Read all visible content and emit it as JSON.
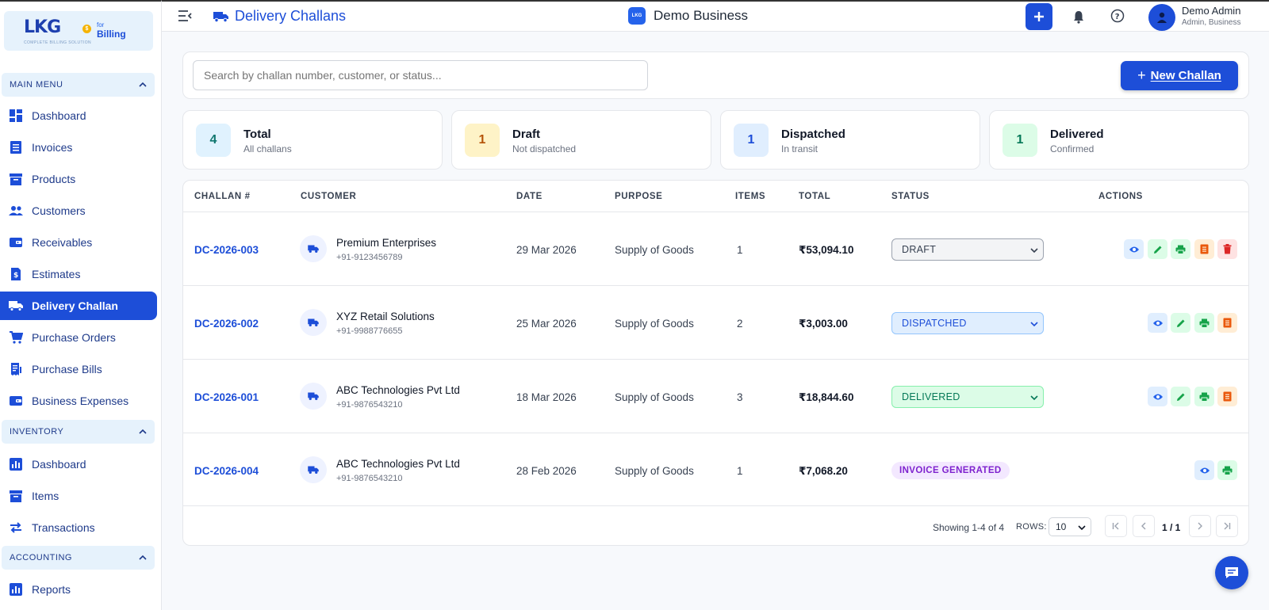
{
  "sidebar": {
    "logo": {
      "brand": "LKG",
      "coin": "$",
      "for": "for",
      "billing": "Billing",
      "tagline": "COMPLETE BILLING SOLUTION"
    },
    "sections": {
      "main": "MAIN MENU",
      "inventory": "INVENTORY",
      "accounting": "ACCOUNTING"
    },
    "items": {
      "dashboard": "Dashboard",
      "invoices": "Invoices",
      "products": "Products",
      "customers": "Customers",
      "receivables": "Receivables",
      "estimates": "Estimates",
      "delivery": "Delivery Challan",
      "purchase_orders": "Purchase Orders",
      "purchase_bills": "Purchase Bills",
      "business_expenses": "Business Expenses",
      "inv_dashboard": "Dashboard",
      "inv_items": "Items",
      "inv_transactions": "Transactions",
      "reports": "Reports"
    }
  },
  "topbar": {
    "title": "Delivery Challans",
    "business_logo": "LKG",
    "business": "Demo Business",
    "user_name": "Demo Admin",
    "user_role": "Admin, Business"
  },
  "toolbar": {
    "search_placeholder": "Search by challan number, customer, or status...",
    "new_button": "New Challan",
    "new_button_plus": "+"
  },
  "stats": [
    {
      "value": "4",
      "label": "Total",
      "sub": "All challans",
      "color": "#0f766e",
      "bg": "#e0f2fe"
    },
    {
      "value": "1",
      "label": "Draft",
      "sub": "Not dispatched",
      "color": "#b45309",
      "bg": "#fef3c7"
    },
    {
      "value": "1",
      "label": "Dispatched",
      "sub": "In transit",
      "color": "#1d4ed8",
      "bg": "#e0eefe"
    },
    {
      "value": "1",
      "label": "Delivered",
      "sub": "Confirmed",
      "color": "#047857",
      "bg": "#dcfce7"
    }
  ],
  "table": {
    "headers": {
      "challan": "CHALLAN #",
      "customer": "CUSTOMER",
      "date": "DATE",
      "purpose": "PURPOSE",
      "items": "ITEMS",
      "total": "TOTAL",
      "status": "STATUS",
      "actions": "ACTIONS"
    },
    "rows": [
      {
        "id": "DC-2026-003",
        "customer": "Premium Enterprises",
        "phone": "+91-9123456789",
        "date": "29 Mar 2026",
        "purpose": "Supply of Goods",
        "items": "1",
        "total": "₹53,094.10",
        "status": "DRAFT"
      },
      {
        "id": "DC-2026-002",
        "customer": "XYZ Retail Solutions",
        "phone": "+91-9988776655",
        "date": "25 Mar 2026",
        "purpose": "Supply of Goods",
        "items": "2",
        "total": "₹3,003.00",
        "status": "DISPATCHED"
      },
      {
        "id": "DC-2026-001",
        "customer": "ABC Technologies Pvt Ltd",
        "phone": "+91-9876543210",
        "date": "18 Mar 2026",
        "purpose": "Supply of Goods",
        "items": "3",
        "total": "₹18,844.60",
        "status": "DELIVERED"
      },
      {
        "id": "DC-2026-004",
        "customer": "ABC Technologies Pvt Ltd",
        "phone": "+91-9876543210",
        "date": "28 Feb 2026",
        "purpose": "Supply of Goods",
        "items": "1",
        "total": "₹7,068.20",
        "status": "INVOICE GENERATED"
      }
    ]
  },
  "pagination": {
    "showing": "Showing 1-4 of 4",
    "rows_label": "ROWS:",
    "rows_value": "10",
    "page": "1 / 1"
  }
}
